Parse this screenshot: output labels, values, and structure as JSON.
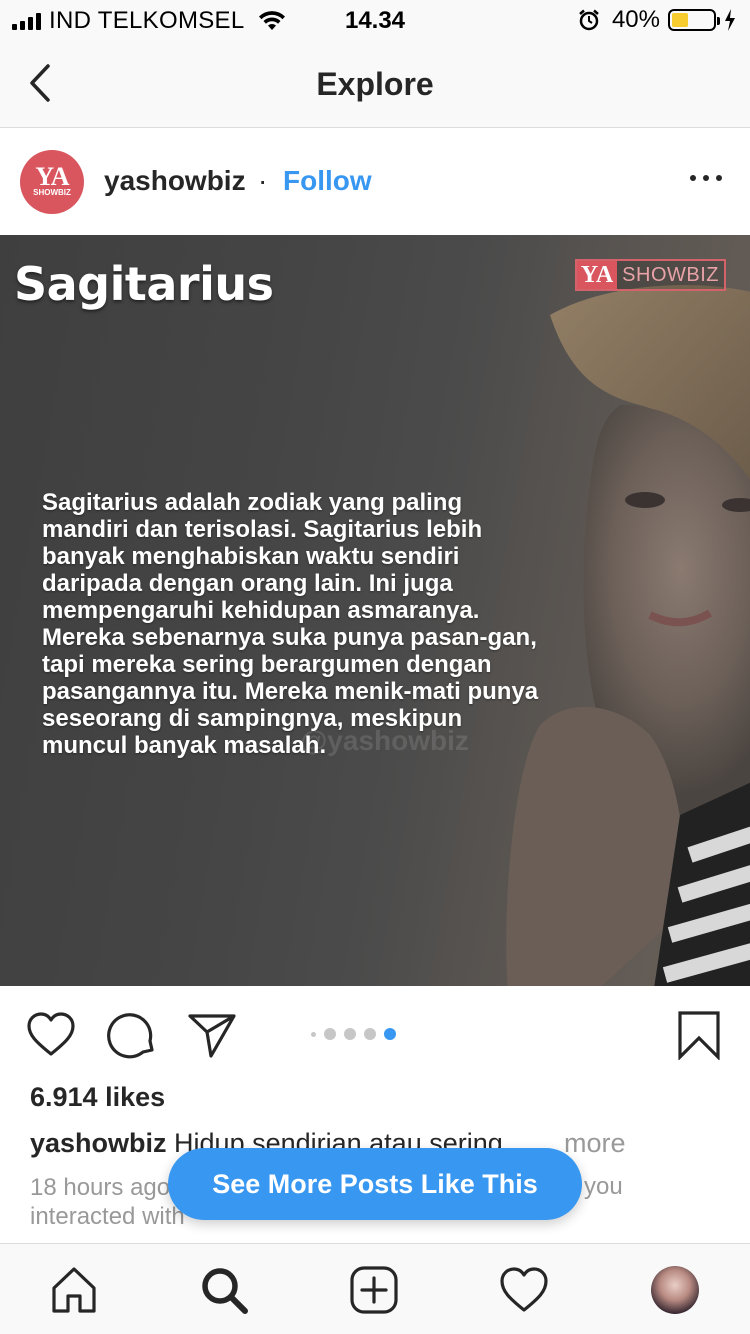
{
  "status_bar": {
    "carrier": "IND TELKOMSEL",
    "time": "14.34",
    "battery_percent": "40%",
    "battery_level": 0.4,
    "battery_color": "#f7cc2e"
  },
  "nav": {
    "title": "Explore",
    "back_icon": "chevron-left-icon"
  },
  "post": {
    "username": "yashowbiz",
    "separator": "·",
    "follow_label": "Follow",
    "avatar_logo": {
      "main": "YA",
      "sub": "SHOWBIZ"
    },
    "more_icon": "more-horizontal-icon",
    "image": {
      "title": "Sagitarius",
      "logo_main": "YA",
      "logo_sub": "SHOWBIZ",
      "watermark": "@yashowbiz",
      "body": "Sagitarius adalah zodiak yang paling mandiri dan terisolasi. Sagitarius lebih banyak menghabiskan waktu sendiri daripada dengan orang lain. Ini juga mempengaruhi kehidupan asmaranya. Mereka sebenarnya suka punya pasan-gan, tapi mereka sering berargumen dengan pasangannya itu. Mereka menik-mati punya seseorang di sampingnya, meskipun muncul banyak masalah."
    },
    "carousel": {
      "count": 5,
      "active_index": 4
    },
    "likes": "6.914 likes",
    "caption_user": "yashowbiz",
    "caption_text": "Hidup sendirian atau sering...",
    "caption_more": "more",
    "timestamp": "18 hours ago",
    "meta_tail": "you",
    "meta_line2": "interacted with"
  },
  "see_more_button": "See More Posts Like This",
  "tabs": [
    "home-icon",
    "search-icon",
    "add-post-icon",
    "activity-heart-icon",
    "profile-avatar"
  ],
  "colors": {
    "accent": "#3897f0",
    "brand": "#d9565f",
    "text": "#262626",
    "muted": "#999999"
  }
}
